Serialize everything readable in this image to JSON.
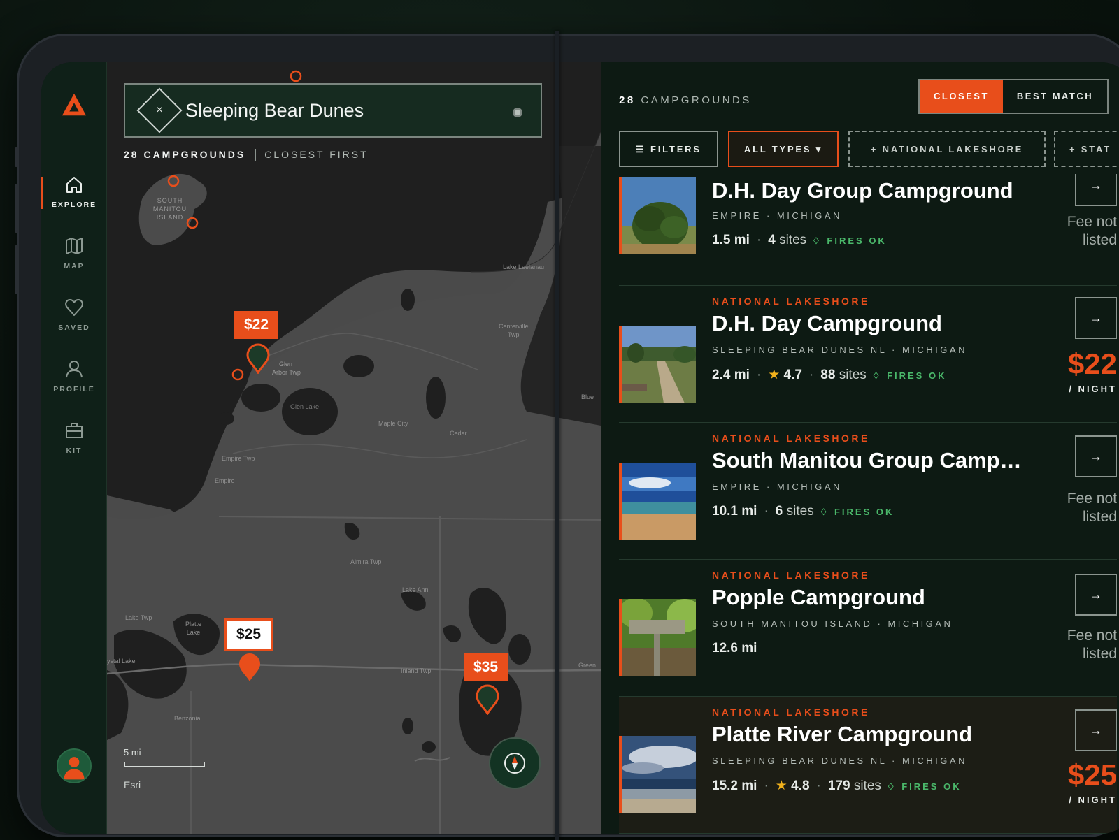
{
  "sidebar": {
    "items": [
      {
        "label": "EXPLORE",
        "icon": "home-icon"
      },
      {
        "label": "MAP",
        "icon": "map-icon"
      },
      {
        "label": "SAVED",
        "icon": "heart-icon"
      },
      {
        "label": "PROFILE",
        "icon": "user-icon"
      },
      {
        "label": "KIT",
        "icon": "briefcase-icon"
      }
    ]
  },
  "map": {
    "search_value": "Sleeping Bear Dunes",
    "clear_symbol": "×",
    "count_label": "28 CAMPGROUNDS",
    "sort_label": "CLOSEST FIRST",
    "price_pins": [
      "$22",
      "$25",
      "$35"
    ],
    "scale_label": "5 mi",
    "attribution": "Esri",
    "place_labels": {
      "south_manitou": [
        "SOUTH",
        "MANITOU",
        "ISLAND"
      ],
      "lake_leelanau": "Lake Leelanau",
      "centerville": [
        "Centerville",
        "Twp"
      ],
      "glen_arbor": [
        "Glen",
        "Arbor Twp"
      ],
      "glen_lake": "Glen Lake",
      "maple_city": "Maple City",
      "cedar": "Cedar",
      "empire_twp": "Empire Twp",
      "empire": "Empire",
      "almira": "Almira Twp",
      "lake_ann": "Lake Ann",
      "lake_twp": "Lake Twp",
      "platte_lake": [
        "Platte",
        "Lake"
      ],
      "crystal_lake": "ystal Lake",
      "inland_twp": "Inland Twp",
      "benzonia": "Benzonia",
      "blue": "Blue",
      "green": "Green"
    }
  },
  "panel": {
    "count_number": "28",
    "count_word": "CAMPGROUNDS",
    "sort_closest": "CLOSEST",
    "sort_best": "BEST MATCH",
    "chip_filters": "☰ FILTERS",
    "chip_types": "ALL TYPES ▾",
    "chip_lakeshore": "+ NATIONAL LAKESHORE",
    "chip_state": "+ STAT"
  },
  "campgrounds": [
    {
      "type": "",
      "name": "D.H. Day Group Campground",
      "location": "EMPIRE · MICHIGAN",
      "distance": "1.5 mi",
      "rating": "",
      "sites": "4",
      "sites_label": "sites",
      "fires": "FIRES OK",
      "fee": "Fee not listed",
      "price": "",
      "per": ""
    },
    {
      "type": "NATIONAL LAKESHORE",
      "name": "D.H. Day Campground",
      "location": "SLEEPING BEAR DUNES NL · MICHIGAN",
      "distance": "2.4 mi",
      "rating": "4.7",
      "sites": "88",
      "sites_label": "sites",
      "fires": "FIRES OK",
      "fee": "",
      "price": "$22",
      "per": "/ NIGHT"
    },
    {
      "type": "NATIONAL LAKESHORE",
      "name": "South Manitou Group Camp…",
      "location": "EMPIRE · MICHIGAN",
      "distance": "10.1 mi",
      "rating": "",
      "sites": "6",
      "sites_label": "sites",
      "fires": "FIRES OK",
      "fee": "Fee not listed",
      "price": "",
      "per": ""
    },
    {
      "type": "NATIONAL LAKESHORE",
      "name": "Popple Campground",
      "location": "SOUTH MANITOU ISLAND · MICHIGAN",
      "distance": "12.6 mi",
      "rating": "",
      "sites": "",
      "sites_label": "",
      "fires": "",
      "fee": "Fee not listed",
      "price": "",
      "per": ""
    },
    {
      "type": "NATIONAL LAKESHORE",
      "name": "Platte River Campground",
      "location": "SLEEPING BEAR DUNES NL · MICHIGAN",
      "distance": "15.2 mi",
      "rating": "4.8",
      "sites": "179",
      "sites_label": "sites",
      "fires": "FIRES OK",
      "fee": "",
      "price": "$25",
      "per": "/ NIGHT"
    }
  ],
  "colors": {
    "accent": "#e84e1b",
    "panel_bg": "#0d1a13",
    "fires_green": "#4ab86a",
    "star": "#f2b21c"
  },
  "arrow_symbol": "→",
  "star_symbol": "★",
  "flame_symbol": "♢"
}
